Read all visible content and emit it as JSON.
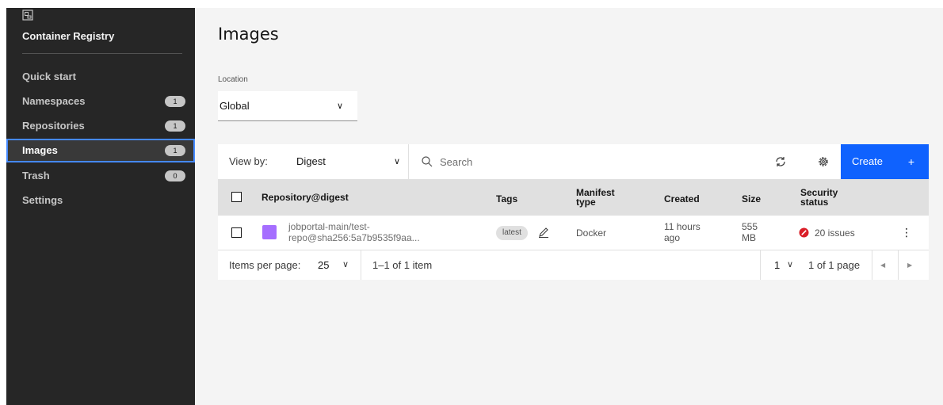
{
  "sidebar": {
    "title": "Container Registry",
    "logo_icon": "registry-logo-icon",
    "items": [
      {
        "label": "Quick start",
        "badge": ""
      },
      {
        "label": "Namespaces",
        "badge": "1"
      },
      {
        "label": "Repositories",
        "badge": "1"
      },
      {
        "label": "Images",
        "badge": "1",
        "active": true
      },
      {
        "label": "Trash",
        "badge": "0"
      },
      {
        "label": "Settings",
        "badge": ""
      }
    ]
  },
  "main": {
    "title": "Images",
    "location": {
      "label": "Location",
      "value": "Global"
    },
    "toolbar": {
      "view_by_label": "View by:",
      "view_by_value": "Digest",
      "search_placeholder": "Search",
      "create_label": "Create",
      "plus": "+"
    },
    "table": {
      "headers": {
        "repository": "Repository@digest",
        "tags": "Tags",
        "manifest_line1": "Manifest",
        "manifest_line2": "type",
        "created": "Created",
        "size": "Size",
        "security_line1": "Security",
        "security_line2": "status"
      },
      "rows": [
        {
          "repo_line1": "jobportal-main/test-",
          "repo_line2": "repo@sha256:5a7b9535f9aa...",
          "tag": "latest",
          "manifest": "Docker",
          "created_line1": "11 hours",
          "created_line2": "ago",
          "size_line1": "555",
          "size_line2": "MB",
          "security": "20 issues"
        }
      ]
    },
    "pagination": {
      "items_per_page_label": "Items per page:",
      "items_per_page_value": "25",
      "range": "1–1 of 1 item",
      "page": "1",
      "page_of": "1 of 1 page"
    }
  },
  "colors": {
    "sidebar_bg": "#262626",
    "accent": "#0f62fe",
    "active_border": "#4589ff",
    "swatch": "#a56eff",
    "danger": "#da1e28"
  }
}
